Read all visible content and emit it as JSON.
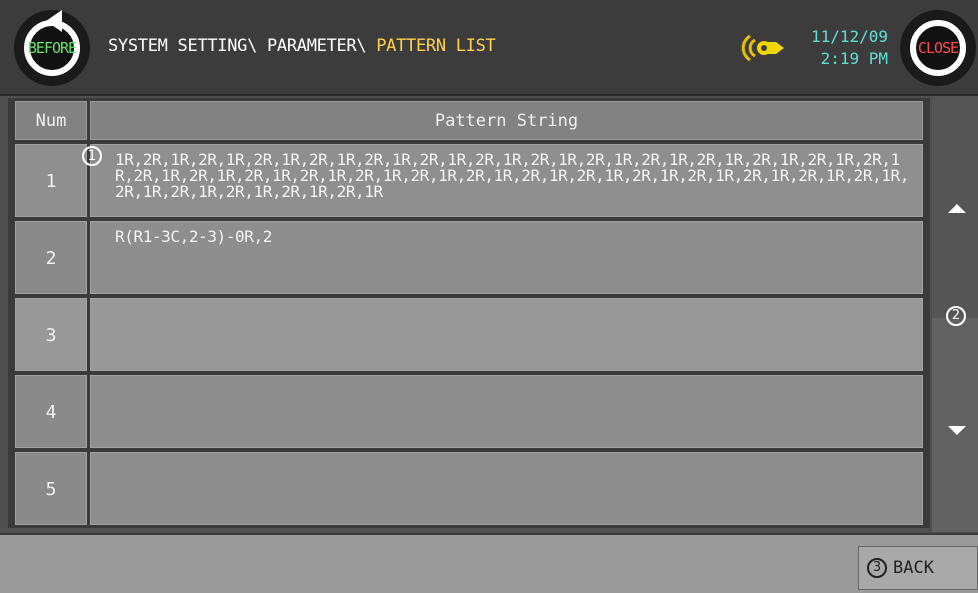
{
  "header": {
    "before_label": "BEFORE",
    "close_label": "CLOSE",
    "breadcrumb_path": "SYSTEM SETTING\\ PARAMETER\\ ",
    "breadcrumb_current": "PATTERN LIST",
    "date": "11/12/09",
    "time": "2:19 PM",
    "alarm_icon": "bell-icon"
  },
  "table": {
    "columns": [
      "Num",
      "Pattern String"
    ],
    "rows": [
      {
        "num": "1",
        "pattern": "1R,2R,1R,2R,1R,2R,1R,2R,1R,2R,1R,2R,1R,2R,1R,2R,1R,2R,1R,2R,1R,2R,1R,2R,1R,2R,1R,2R,1R,2R,1R,2R,1R,2R,1R,2R,1R,2R,1R,2R,1R,2R,1R,2R,1R,2R,1R,2R,1R,2R,1R,2R,1R,2R,1R,2R,1R,2R,1R,2R,1R,2R,1R,2R,1R,2R,1R"
      },
      {
        "num": "2",
        "pattern": "R(R1-3C,2-3)-0R,2"
      },
      {
        "num": "3",
        "pattern": ""
      },
      {
        "num": "4",
        "pattern": ""
      },
      {
        "num": "5",
        "pattern": ""
      }
    ]
  },
  "markers": {
    "m1": "1",
    "m2": "2",
    "m3": "3"
  },
  "footer": {
    "back_label": "BACK"
  },
  "colors": {
    "highlight": "#ffd24a",
    "datetime": "#5fe0d4",
    "before": "#6ce36c",
    "close": "#ff4b4b"
  }
}
